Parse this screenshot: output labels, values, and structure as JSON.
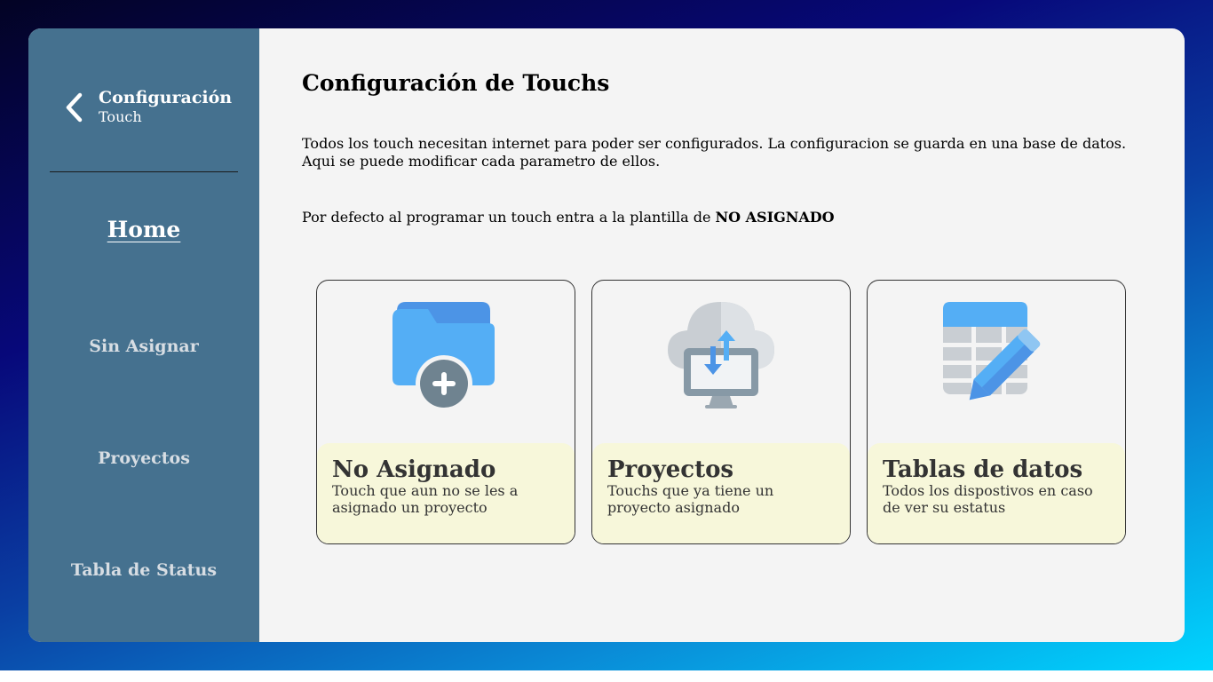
{
  "sidebar": {
    "title": "Configuración",
    "subtitle": "Touch",
    "items": [
      {
        "label": "Home",
        "active": true
      },
      {
        "label": "Sin Asignar"
      },
      {
        "label": "Proyectos"
      },
      {
        "label": "Tabla de Status"
      }
    ]
  },
  "main": {
    "title": "Configuración de Touchs",
    "intro": "Todos los touch necesitan internet para poder ser configurados. La configuracion se guarda en una base de datos. Aqui se puede modificar cada parametro de ellos.",
    "note_prefix": "Por defecto al programar un touch entra a la plantilla de ",
    "note_highlight": "NO ASIGNADO"
  },
  "cards": [
    {
      "title": "No Asignado",
      "description": "Touch que aun no se les a asignado un proyecto",
      "icon": "folder-add-icon"
    },
    {
      "title": "Proyectos",
      "description": "Touchs que ya tiene un proyecto asignado",
      "icon": "cloud-monitor-sync-icon"
    },
    {
      "title": "Tablas de datos",
      "description": "Todos los dispostivos en caso de ver su estatus",
      "icon": "table-edit-icon"
    }
  ],
  "colors": {
    "sidebar_bg": "#45718f",
    "card_footer_bg": "#f7f7da",
    "icon_blue": "#54aef5",
    "icon_gray": "#6f8390"
  }
}
